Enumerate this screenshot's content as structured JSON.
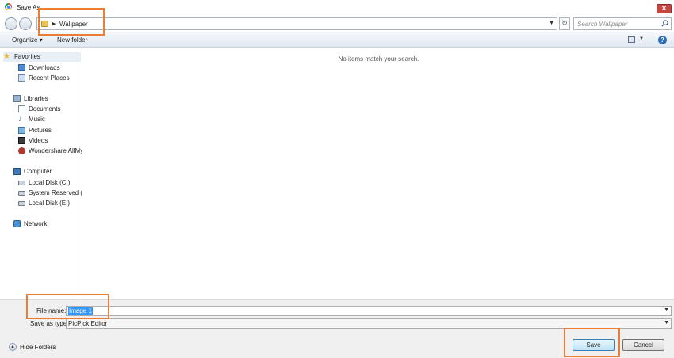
{
  "window": {
    "title": "Save As"
  },
  "address_bar": {
    "path": "Wallpaper"
  },
  "search": {
    "placeholder": "Search Wallpaper"
  },
  "toolbar": {
    "organize_label": "Organize ▾",
    "new_folder_label": "New folder"
  },
  "nav": {
    "items": [
      {
        "label": "Favorites",
        "icon": "star-icon"
      },
      {
        "label": "Downloads",
        "icon": "downloads-icon"
      },
      {
        "label": "Recent Places",
        "icon": "recent-places-icon"
      },
      {
        "label": "Libraries",
        "icon": "libraries-icon"
      },
      {
        "label": "Documents",
        "icon": "documents-icon"
      },
      {
        "label": "Music",
        "icon": "music-icon"
      },
      {
        "label": "Pictures",
        "icon": "pictures-icon"
      },
      {
        "label": "Videos",
        "icon": "videos-icon"
      },
      {
        "label": "Wondershare AllMy",
        "icon": "wondershare-icon"
      },
      {
        "label": "Computer",
        "icon": "computer-icon"
      },
      {
        "label": "Local Disk (C:)",
        "icon": "disk-icon"
      },
      {
        "label": "System Reserved (D:",
        "icon": "disk-icon"
      },
      {
        "label": "Local Disk (E:)",
        "icon": "disk-icon"
      },
      {
        "label": "Network",
        "icon": "network-icon"
      }
    ]
  },
  "content": {
    "empty_message": "No items match your search."
  },
  "form": {
    "file_name_label": "File name:",
    "file_name_value": "Image 1",
    "save_type_label": "Save as type:",
    "save_type_value": "PicPick Editor"
  },
  "footer": {
    "hide_folders_label": "Hide Folders"
  },
  "buttons": {
    "save_label": "Save",
    "cancel_label": "Cancel"
  },
  "colors": {
    "highlight": "#ed7d31",
    "selection": "#3399ff",
    "close": "#c7463f"
  }
}
